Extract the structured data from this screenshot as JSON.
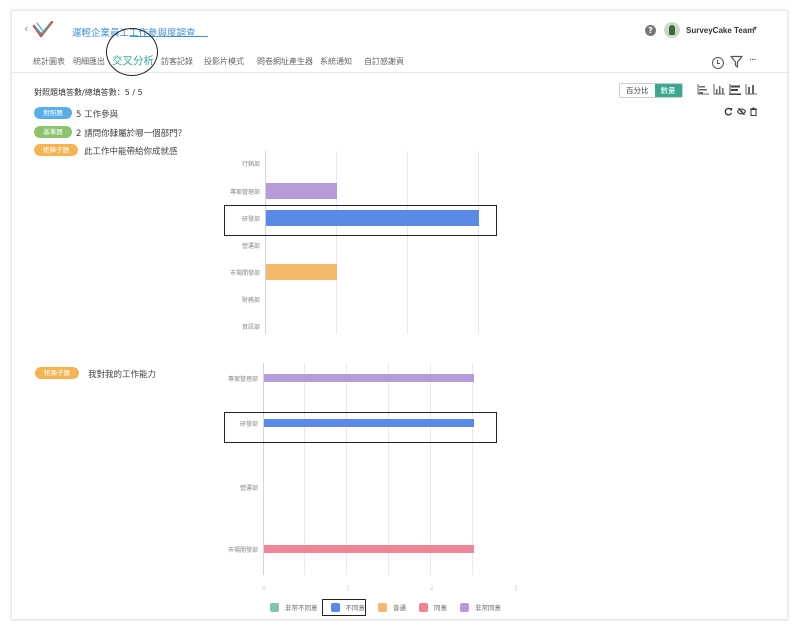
{
  "header": {
    "survey_title": "運輕企業員工工作參與度調查",
    "user_name": "SurveyCake Team"
  },
  "nav": {
    "items": [
      "統計圖表",
      "明細匯出",
      "交叉分析",
      "訪客記錄",
      "投影片模式",
      "問卷網址產生器",
      "系統通知",
      "自訂感謝頁"
    ],
    "active_index": 2
  },
  "toolbar": {
    "count_text": "對照題填答數/總填答數：5 / 5",
    "toggle_percent": "百分比",
    "toggle_count": "數量",
    "active_toggle": "數量"
  },
  "filters": {
    "compare": {
      "tag": "對照題",
      "text": "5 工作參與"
    },
    "base": {
      "tag": "基準題",
      "text": "2 請問你隸屬於哪一個部門？"
    },
    "matrix1": {
      "tag": "矩陣子題",
      "text": "此工作中能帶給你成就感"
    },
    "matrix2": {
      "tag": "矩陣子題",
      "text": "我對我的工作能力"
    }
  },
  "colors": {
    "strongly_disagree": "#7fc6b2",
    "disagree": "#5b8ae6",
    "neutral": "#f5b76b",
    "agree": "#ee8597",
    "strongly_agree": "#b79ad8",
    "compare_tag": "#5aaee6",
    "base_tag": "#8dc26f",
    "matrix_tag": "#f5b454",
    "accent": "#3aa88f"
  },
  "chart_data": [
    {
      "type": "bar",
      "orientation": "horizontal",
      "title": "此工作中能帶給你成就感",
      "categories": [
        "行銷部",
        "專案管理部",
        "研發部",
        "營運部",
        "市場開發部",
        "財務部",
        "資訊部"
      ],
      "series": [
        {
          "name": "非常不同意",
          "values": [
            0,
            0,
            0,
            0,
            0,
            0,
            0
          ]
        },
        {
          "name": "不同意",
          "values": [
            0,
            0,
            3,
            0,
            0,
            0,
            0
          ]
        },
        {
          "name": "普通",
          "values": [
            0,
            0,
            0,
            0,
            1,
            0,
            0
          ]
        },
        {
          "name": "同意",
          "values": [
            0,
            0,
            0,
            0,
            0,
            0,
            0
          ]
        },
        {
          "name": "非常同意",
          "values": [
            0,
            1,
            0,
            0,
            0,
            0,
            0
          ]
        }
      ],
      "xlim": [
        0,
        3
      ],
      "grid": true,
      "highlighted_category": "研發部"
    },
    {
      "type": "bar",
      "orientation": "horizontal",
      "title": "我對我的工作能力",
      "categories": [
        "專案管理部",
        "研發部",
        "營運部",
        "市場開發部"
      ],
      "series": [
        {
          "name": "非常不同意",
          "values": [
            0,
            0,
            0,
            0
          ]
        },
        {
          "name": "不同意",
          "values": [
            0,
            2.5,
            0,
            0
          ]
        },
        {
          "name": "普通",
          "values": [
            0,
            0,
            0,
            0
          ]
        },
        {
          "name": "同意",
          "values": [
            0,
            0,
            0,
            2.5
          ]
        },
        {
          "name": "非常同意",
          "values": [
            2.5,
            0,
            0,
            0
          ]
        }
      ],
      "x_ticks": [
        "0",
        "1",
        "2",
        "3"
      ],
      "xlim": [
        0,
        3
      ],
      "grid": true,
      "highlighted_category": "研發部"
    }
  ],
  "legend": {
    "items": [
      "非常不同意",
      "不同意",
      "普通",
      "同意",
      "非常同意"
    ],
    "highlighted": "不同意"
  }
}
